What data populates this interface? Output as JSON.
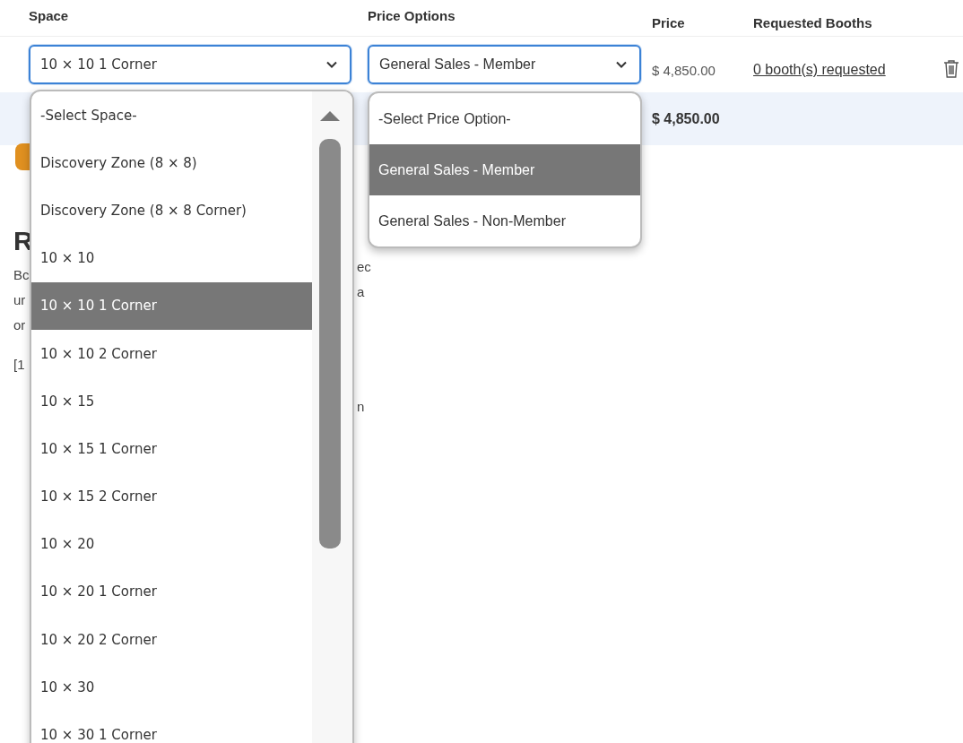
{
  "columns": [
    {
      "label": "Space"
    },
    {
      "label": "Price Options"
    },
    {
      "label": "Price"
    },
    {
      "label": "Requested Booths"
    }
  ],
  "row": {
    "space_select": {
      "value": "10 × 10 1 Corner"
    },
    "price_select": {
      "value": "General Sales - Member"
    },
    "price": "$ 4,850.00",
    "requested_link": "0 booth(s) requested"
  },
  "total_row": {
    "price": "$ 4,850.00"
  },
  "space_menu": {
    "options": [
      {
        "label": "-Select Space-",
        "selected": false
      },
      {
        "label": "Discovery Zone (8 × 8)",
        "selected": false
      },
      {
        "label": "Discovery Zone (8 × 8 Corner)",
        "selected": false
      },
      {
        "label": "10 × 10",
        "selected": false
      },
      {
        "label": "10 × 10 1 Corner",
        "selected": true
      },
      {
        "label": "10 × 10 2 Corner",
        "selected": false
      },
      {
        "label": "10 × 15",
        "selected": false
      },
      {
        "label": "10 × 15 1 Corner",
        "selected": false
      },
      {
        "label": "10 × 15 2 Corner",
        "selected": false
      },
      {
        "label": "10 × 20",
        "selected": false
      },
      {
        "label": "10 × 20 1 Corner",
        "selected": false
      },
      {
        "label": "10 × 20 2 Corner",
        "selected": false
      },
      {
        "label": "10 × 30",
        "selected": false
      },
      {
        "label": "10 × 30 1 Corner",
        "selected": false
      }
    ]
  },
  "price_menu": {
    "options": [
      {
        "label": "-Select Price Option-",
        "selected": false
      },
      {
        "label": "General Sales - Member",
        "selected": true
      },
      {
        "label": "General Sales - Non-Member",
        "selected": false
      }
    ]
  },
  "page_behind": {
    "heading": "R",
    "left_text": [
      "Bc",
      "ur",
      "or",
      "[1"
    ],
    "right_text": [
      "ec",
      "a",
      "n"
    ]
  }
}
